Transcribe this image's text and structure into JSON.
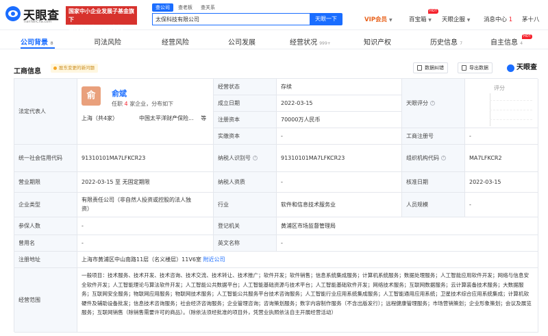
{
  "header": {
    "logo_text": "天眼查",
    "logo_sub": "TianYanCha.com",
    "banner_line1": "国家中小企业发展子基金旗下",
    "banner_line2": "官方备案企业征信机构",
    "search_tabs": [
      "查公司",
      "查老板",
      "查关系"
    ],
    "search_value": "太保科技有限公司",
    "search_button": "天眼一下",
    "vip": "VIP会员",
    "items": [
      "百宝箱",
      "天眼企服",
      "消息中心",
      "茅十八"
    ],
    "hot_label": "HOT",
    "message_count": "1"
  },
  "tabs": [
    {
      "label": "公司背景",
      "count": "8"
    },
    {
      "label": "司法风险",
      "count": ""
    },
    {
      "label": "经营风险",
      "count": ""
    },
    {
      "label": "公司发展",
      "count": ""
    },
    {
      "label": "经营状况",
      "count": "999+"
    },
    {
      "label": "知识产权",
      "count": ""
    },
    {
      "label": "历史信息",
      "count": "7"
    },
    {
      "label": "自主信息",
      "count": "4"
    }
  ],
  "section": {
    "title": "工商信息",
    "pill": "股东变更的新问题",
    "buttons": [
      "数据纠错",
      "导出数据"
    ],
    "watermark": "天眼查"
  },
  "table": {
    "legal_rep_label": "法定代表人",
    "avatar_char": "俞",
    "rep_name": "俞斌",
    "rep_sub_prefix": "任职",
    "rep_sub_count": "4",
    "rep_sub_suffix": "家企业，分布如下",
    "rep_loc": "上海（共4家）",
    "rep_co": "中国太平洋财产保险...",
    "rep_more": "等",
    "status_label": "经营状态",
    "status_value": "存续",
    "rating_label": "天眼评分",
    "rating_title": "评分",
    "founded_label": "成立日期",
    "founded_value": "2022-03-15",
    "reg_cap_label": "注册资本",
    "reg_cap_value": "70000万人民币",
    "paid_cap_label": "实缴资本",
    "paid_cap_value": "-",
    "biz_reg_no_label": "工商注册号",
    "biz_reg_no_value": "-",
    "credit_code_label": "统一社会信用代码",
    "credit_code_value": "91310101MA7LFKCR23",
    "taxpayer_id_label": "纳税人识别号",
    "taxpayer_id_value": "91310101MA7LFKCR23",
    "org_code_label": "组织机构代码",
    "org_code_value": "MA7LFKCR2",
    "term_label": "营业期限",
    "term_value": "2022-03-15 至 无固定期限",
    "taxpayer_qual_label": "纳税人资质",
    "taxpayer_qual_value": "-",
    "approval_label": "核准日期",
    "approval_value": "2022-03-15",
    "type_label": "企业类型",
    "type_value_1": "有限责任公司（非自然人投资或控股的法人独",
    "type_value_2": "资）",
    "industry_label": "行业",
    "industry_value": "软件和信息技术服务业",
    "staff_label": "人员规模",
    "staff_value": "-",
    "insured_label": "参保人数",
    "insured_value": "-",
    "authority_label": "登记机关",
    "authority_value": "黄浦区市场监督管理局",
    "former_label": "曾用名",
    "former_value": "-",
    "english_label": "英文名称",
    "english_value": "-",
    "address_label": "注册地址",
    "address_value": "上海市黄浦区中山南路11层（名义楼层）11V6室",
    "address_link": "附近公司",
    "scope_label": "经营范围",
    "scope_value": "一般项目：技术服务、技术开发、技术咨询、技术交流、技术转让、技术推广；软件开发；软件销售；信息系统集成服务；计算机系统服务；数据处理服务；人工智能应用软件开发；网络与信息安全软件开发；人工智能理论与算法软件开发；人工智能公共数据平台；人工智能基础资源与技术平台；人工智能基础软件开发；网络技术服务；互联网数据服务；云计算装备技术服务；大数据服务；互联网安全服务；物联网应用服务；物联网技术服务；人工智能公共服务平台技术咨询服务；人工智能行业应用系统集成服务；人工智能通用应用系统；卫星技术综合应用系统集成；计算机软硬件及辅助设备批发；信息技术咨询服务；社会经济咨询服务；企业管理咨询；咨询策划服务；数字内容制作服务（不含出版发行）；远程健康管理服务；市场营销策划；企业形象策划；会议及展览服务；互联网销售（除销售需要许可的商品）。（除依法须经批准的项目外，凭营业执照依法自主开展经营活动）"
  },
  "colors": {
    "brand": "#1a6dff",
    "vip": "#e8611a",
    "banner": "#d7322d",
    "hot": "#f5222d"
  },
  "icons": [
    "logo-eye-icon",
    "question-icon",
    "edit-icon",
    "export-icon",
    "chevron-down-icon"
  ]
}
